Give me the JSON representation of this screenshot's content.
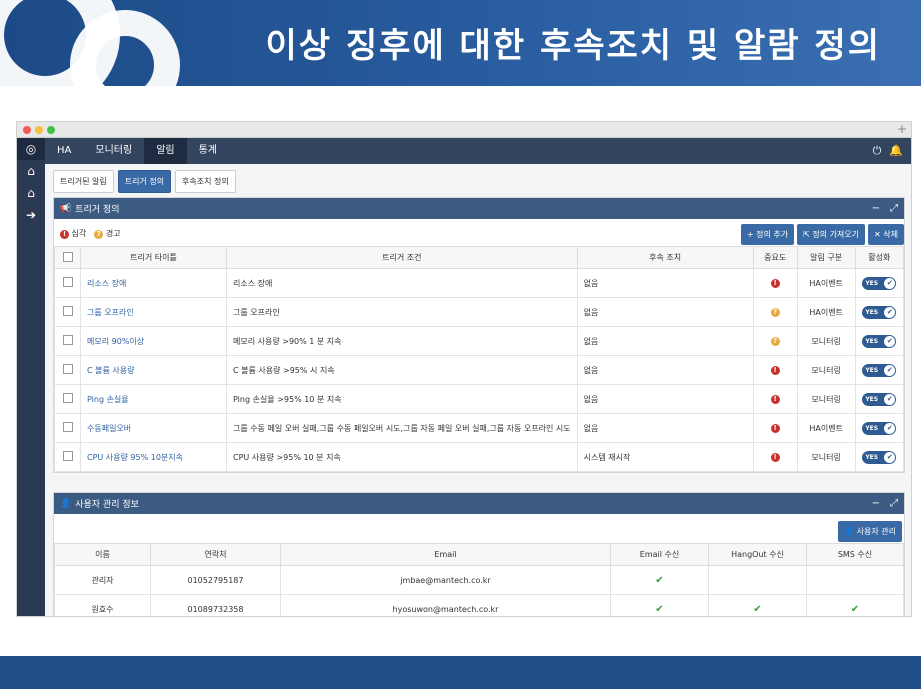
{
  "banner": {
    "title": "이상 징후에 대한 후속조치 및 알람 정의"
  },
  "nav": {
    "items": [
      "HA",
      "모니터링",
      "알림",
      "통계"
    ],
    "active": "알림"
  },
  "subtabs": [
    "트리거된 알림",
    "트리거 정의",
    "후속조치 정의"
  ],
  "trigger_panel": {
    "title": "트리거 정의",
    "legend_critical": "심각",
    "legend_warning": "경고",
    "btn_add": "정의 추가",
    "btn_import": "정의 가져오기",
    "btn_delete": "삭제",
    "columns": [
      "트리거 타이틀",
      "트리거 조건",
      "후속 조치",
      "중요도",
      "알림 구분",
      "활성화"
    ],
    "rows": [
      {
        "title": "리소스 장애",
        "condition": "리소스 장애",
        "action": "없음",
        "severity": "critical",
        "type": "HA이벤트",
        "enabled": "YES"
      },
      {
        "title": "그룹 오프라인",
        "condition": "그룹 오프라인",
        "action": "없음",
        "severity": "warning",
        "type": "HA이벤트",
        "enabled": "YES"
      },
      {
        "title": "메모리 90%이상",
        "condition": "메모리 사용량 >90% 1 분 지속",
        "action": "없음",
        "severity": "warning",
        "type": "모니터링",
        "enabled": "YES"
      },
      {
        "title": "C 볼륨 사용량",
        "condition": "C 볼륨 사용량 >95% 시 지속",
        "action": "없음",
        "severity": "critical",
        "type": "모니터링",
        "enabled": "YES"
      },
      {
        "title": "Ping 손실율",
        "condition": "Ping 손실율 >95% 10 분 지속",
        "action": "없음",
        "severity": "critical",
        "type": "모니터링",
        "enabled": "YES"
      },
      {
        "title": "수동페일오버",
        "condition": "그룹 수동 페일 오버 실패,그룹 수동 페일오버 시도,그룹 자동 페일 오버 실패,그룹 자동 오프라인 시도",
        "action": "없음",
        "severity": "critical",
        "type": "HA이벤트",
        "enabled": "YES"
      },
      {
        "title": "CPU 사용량 95% 10분지속",
        "condition": "CPU 사용량 >95% 10 분 지속",
        "action": "시스템 재시작",
        "severity": "critical",
        "type": "모니터링",
        "enabled": "YES"
      }
    ]
  },
  "user_panel": {
    "title": "사용자 관리 정보",
    "btn_manage": "사용자 관리",
    "columns": [
      "이름",
      "연락처",
      "Email",
      "Email 수신",
      "HangOut 수신",
      "SMS 수신"
    ],
    "rows": [
      {
        "name": "관리자",
        "phone": "01052795187",
        "email": "jmbae@mantech.co.kr",
        "email_rx": true,
        "hangout_rx": false,
        "sms_rx": false
      },
      {
        "name": "원효수",
        "phone": "01089732358",
        "email": "hyosuwon@mantech.co.kr",
        "email_rx": true,
        "hangout_rx": true,
        "sms_rx": true
      }
    ]
  },
  "colors": {
    "navy": "#33445f",
    "accent": "#3a6aa5",
    "critical": "#c9302c",
    "warning": "#e8a93a",
    "check": "#3aa03a"
  }
}
